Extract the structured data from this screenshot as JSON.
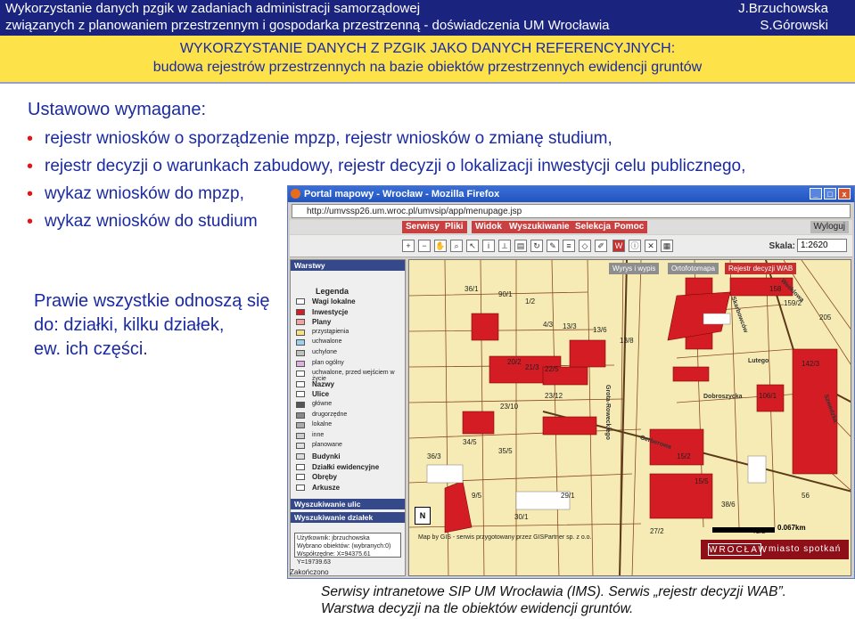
{
  "header": {
    "line1": "Wykorzystanie danych pzgik w zadaniach administracji samorządowej",
    "line2": "związanych z planowaniem przestrzennym i gospodarka przestrzenną - doświadczenia UM Wrocławia",
    "author1": "J.Brzuchowska",
    "author2": "S.Górowski"
  },
  "title": {
    "line1": "WYKORZYSTANIE DANYCH Z PZGIK JAKO DANYCH REFERENCYJNYCH:",
    "line2": "budowa rejestrów przestrzennych na bazie obiektów przestrzennych ewidencji gruntów"
  },
  "content": {
    "intro": "Ustawowo wymagane:",
    "bullets": [
      "rejestr wniosków o sporządzenie mpzp, rejestr wniosków o zmianę studium,",
      "rejestr decyzji o warunkach zabudowy, rejestr decyzji o lokalizacji inwestycji celu publicznego,",
      "wykaz wniosków do mpzp,",
      "wykaz wniosków do studium"
    ],
    "note_lines": [
      "Prawie wszystkie odnoszą się",
      "do: działki, kilku działek,",
      "ew. ich części."
    ]
  },
  "caption": {
    "line1": "Serwisy intranetowe SIP UM Wrocławia (IMS). Serwis „rejestr decyzji WAB”.",
    "line2": "Warstwa decyzji na tle obiektów ewidencji gruntów."
  },
  "browser": {
    "title": "Portal mapowy - Wrocław - Mozilla Firefox",
    "address": "http://umvssp26.um.wroc.pl/umvsip/app/menupage.jsp",
    "menu": [
      "Serwisy",
      "Pliki",
      "Widok",
      "Wyszukiwanie",
      "Selekcja",
      "Pomoc"
    ],
    "logout": "Wyloguj",
    "scale_label": "Skala:",
    "scale_value": "1:2620",
    "panels": {
      "layers": "Warstwy",
      "search_streets": "Wyszukiwanie ulic",
      "search_parcels": "Wyszukiwanie działek"
    },
    "legend": {
      "title": "Legenda",
      "items": [
        {
          "label": "Wagi lokalne",
          "bold": true
        },
        {
          "label": "Inwestycje",
          "bold": true
        },
        {
          "label": "Plany",
          "bold": true
        },
        {
          "label": "przystąpienia",
          "bold": false
        },
        {
          "label": "uchwalone",
          "bold": false
        },
        {
          "label": "uchylone",
          "bold": false
        },
        {
          "label": "plan ogólny",
          "bold": false
        },
        {
          "label": "uchwalone, przed wejściem w życie",
          "bold": false
        },
        {
          "label": "Nazwy",
          "bold": true
        },
        {
          "label": "Ulice",
          "bold": true
        },
        {
          "label": "główne",
          "bold": false
        },
        {
          "label": "drugorzędne",
          "bold": false
        },
        {
          "label": "lokalne",
          "bold": false
        },
        {
          "label": "inne",
          "bold": false
        },
        {
          "label": "planowane",
          "bold": false
        },
        {
          "label": "Budynki",
          "bold": true
        },
        {
          "label": "Działki ewidencyjne",
          "bold": true
        },
        {
          "label": "Obręby",
          "bold": true
        },
        {
          "label": "Arkusze",
          "bold": true
        }
      ]
    },
    "coords": {
      "user": "Użytkownik: jbrzuchowska",
      "selected": "Wybrano obiektów: (wybranych:0)",
      "position": "Współrzędne: X=94375.61 Y=19739.63"
    },
    "status": "Zakończono",
    "map_tabs": [
      "Wyrys i wypis",
      "Ortofotomapa",
      "Rejestr decyzji WAB"
    ],
    "streets": [
      "Grota-Roweckiego",
      "Gerberowa",
      "Skarbowców",
      "Weeklowa",
      "Lutego",
      "Szwedzka",
      "Dobroszycka"
    ],
    "parcel_labels": [
      "36/1",
      "90/1",
      "1/2",
      "4/3",
      "13/3",
      "13/6",
      "13/8",
      "20/2",
      "21/3",
      "22/5",
      "23/10",
      "23/12",
      "34/5",
      "35/5",
      "36/3",
      "9/5",
      "15/2",
      "15/5",
      "29/1",
      "30/1",
      "27/2",
      "38/6",
      "41/2",
      "56",
      "106/1",
      "158",
      "159/2",
      "142/3",
      "205"
    ],
    "scalebar_text": "0.067km",
    "copyright": "Map by GIS - serwis przygotowany przez GISPartner sp. z o.o.",
    "brand_main": "WROCŁAW",
    "brand_sub": "miasto spotkań"
  },
  "colors": {
    "header_bg": "#1a237e",
    "band_bg": "#fde24a",
    "text_blue": "#1a2aa0",
    "bullet_red": "#e0161a",
    "map_bg": "#f6ebb4",
    "parcel_red": "#d41c24"
  }
}
